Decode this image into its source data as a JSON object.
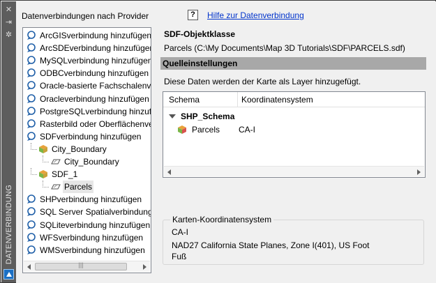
{
  "strip": {
    "title": "DATENVERBINDUNG",
    "icons": [
      "close-icon",
      "auto-hide-icon",
      "properties-icon",
      "autocad-logo-icon"
    ]
  },
  "left_panel": {
    "title": "Datenverbindungen nach Provider",
    "tree": [
      {
        "label": "ArcGISverbindung hinzufügen",
        "level": 0
      },
      {
        "label": "ArcSDEverbindung hinzufügen",
        "level": 0
      },
      {
        "label": "MySQLverbindung hinzufügen",
        "level": 0
      },
      {
        "label": "ODBCverbindung hinzufügen",
        "level": 0
      },
      {
        "label": "Oracle-basierte Fachschalenve",
        "level": 0
      },
      {
        "label": "Oracleverbindung hinzufügen",
        "level": 0
      },
      {
        "label": "PostgreSQLverbindung hinzufü",
        "level": 0
      },
      {
        "label": "Rasterbild oder Oberflächenverb",
        "level": 0
      },
      {
        "label": "SDFverbindung hinzufügen",
        "level": 0
      },
      {
        "label": "City_Boundary",
        "level": 1
      },
      {
        "label": "City_Boundary",
        "level": 2
      },
      {
        "label": "SDF_1",
        "level": 1
      },
      {
        "label": "Parcels",
        "level": 2,
        "selected": true
      },
      {
        "label": "SHPverbindung hinzufügen",
        "level": 0
      },
      {
        "label": "SQL Server Spatialverbindung",
        "level": 0
      },
      {
        "label": "SQLiteverbindung hinzufügen",
        "level": 0
      },
      {
        "label": "WFSverbindung hinzufügen",
        "level": 0
      },
      {
        "label": "WMSverbindung hinzufügen",
        "level": 0
      }
    ]
  },
  "help": {
    "icon_text": "?",
    "link": "Hilfe zur Datenverbindung"
  },
  "main": {
    "class_title": "SDF-Objektklasse",
    "class_path": "Parcels (C:\\My Documents\\Map 3D Tutorials\\SDF\\PARCELS.sdf)",
    "source_header": "Quelleinstellungen",
    "source_desc": "Diese Daten werden der Karte als Layer hinzugefügt.",
    "grid": {
      "columns": [
        "Schema",
        "Koordinatensystem"
      ],
      "schema_row": "SHP_Schema",
      "rows": [
        {
          "name": "Parcels",
          "cs": "CA-I"
        }
      ]
    },
    "coords_group": {
      "legend": "Karten-Koordinatensystem",
      "code": "CA-I",
      "description": "NAD27 California State Planes, Zone I(401), US Foot",
      "unit": "Fuß"
    }
  }
}
